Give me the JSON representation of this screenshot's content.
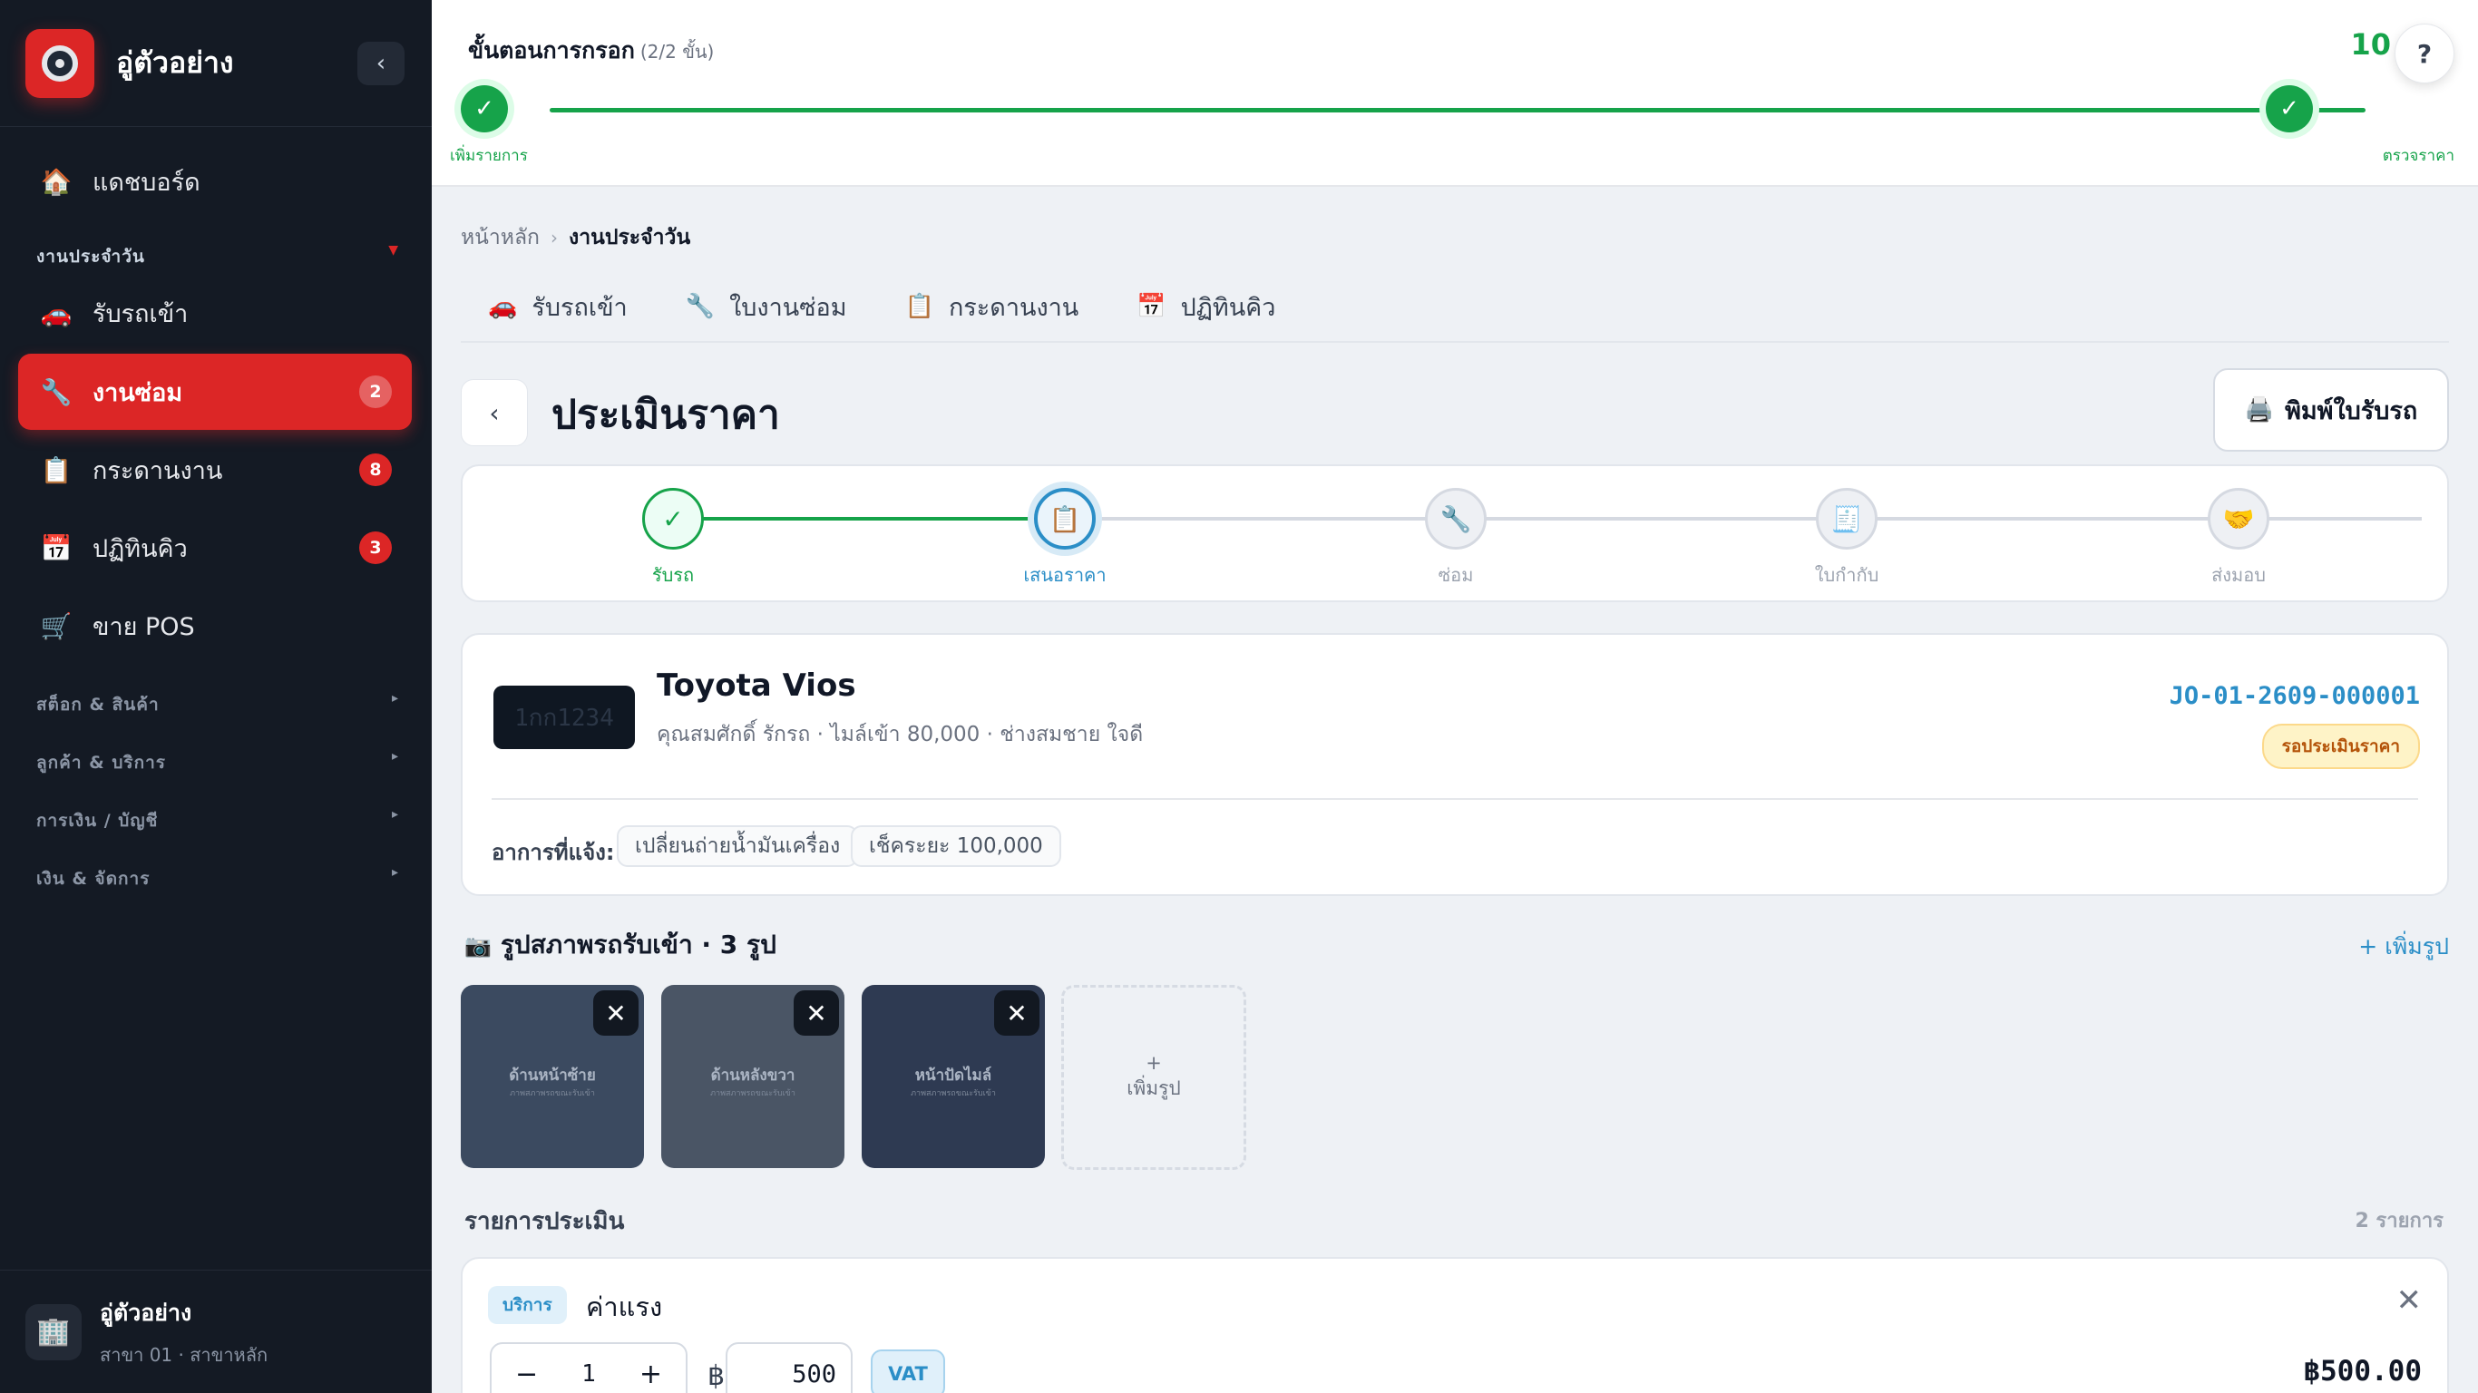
{
  "sidebar": {
    "app_name": "อู่ตัวอย่าง",
    "collapse_icon": "‹",
    "dashboard": "แดชบอร์ด",
    "section_daily": "งานประจำวัน",
    "items": [
      {
        "label": "รับรถเข้า",
        "badge": ""
      },
      {
        "label": "งานซ่อม",
        "badge": "2"
      },
      {
        "label": "กระดานงาน",
        "badge": "8"
      },
      {
        "label": "ปฏิทินคิว",
        "badge": "3"
      },
      {
        "label": "ขาย POS",
        "badge": ""
      }
    ],
    "sections": [
      "สต็อก & สินค้า",
      "ลูกค้า & บริการ",
      "การเงิน / บัญชี",
      "เงิน & จัดการ"
    ],
    "footer": {
      "name": "อู่ตัวอย่าง",
      "sub": "สาขา 01 · สาขาหลัก"
    }
  },
  "progress": {
    "title": "ขั้นตอนการกรอก",
    "step_count": "(2/2 ขั้น)",
    "percent_visible": "10",
    "percent_value": 100,
    "step1_label": "เพิ่มรายการ",
    "step2_label": "ตรวจราคา",
    "help": "?"
  },
  "breadcrumb": {
    "home": "หน้าหลัก",
    "current": "งานประจำวัน"
  },
  "tabs": [
    {
      "label": "รับรถเข้า",
      "icon": "car-icon"
    },
    {
      "label": "ใบงานซ่อม",
      "icon": "wrench-icon"
    },
    {
      "label": "กระดานงาน",
      "icon": "clipboard-icon"
    },
    {
      "label": "ปฏิทินคิว",
      "icon": "calendar-icon"
    }
  ],
  "page": {
    "title": "ประเมินราคา",
    "print_label": "พิมพ์ใบรับรถ",
    "back": "‹"
  },
  "stepper": [
    {
      "label": "รับรถ",
      "state": "done",
      "icon": "check-icon"
    },
    {
      "label": "เสนอราคา",
      "state": "current",
      "icon": "clipboard-icon"
    },
    {
      "label": "ซ่อม",
      "state": "todo",
      "icon": "wrench-icon"
    },
    {
      "label": "ใบกำกับ",
      "state": "todo",
      "icon": "receipt-icon"
    },
    {
      "label": "ส่งมอบ",
      "state": "todo",
      "icon": "handshake-icon"
    }
  ],
  "vehicle": {
    "plate": "1กก1234",
    "name": "Toyota Vios",
    "details": "คุณสมศักดิ์ รักรถ · ไมล์เข้า 80,000 · ช่างสมชาย ใจดี",
    "job_no": "JO-01-2609-000001",
    "status": "รอประเมินราคา",
    "symptom_label": "อาการที่แจ้ง:",
    "symptoms": [
      "เปลี่ยนถ่ายน้ำมันเครื่อง",
      "เช็คระยะ 100,000"
    ]
  },
  "photos": {
    "title": "รูปสภาพรถรับเข้า · 3 รูป",
    "add_link": "+ เพิ่มรูป",
    "items": [
      {
        "caption": "ด้านหน้าซ้าย",
        "sub": "ภาพสภาพรถขณะรับเข้า",
        "color": "#3b4a60"
      },
      {
        "caption": "ด้านหลังขวา",
        "sub": "ภาพสภาพรถขณะรับเข้า",
        "color": "#4a5565"
      },
      {
        "caption": "หน้าปัดไมล์",
        "sub": "ภาพสภาพรถขณะรับเข้า",
        "color": "#2e3a52"
      }
    ],
    "add_plus": "+",
    "add_label": "เพิ่มรูป"
  },
  "items": {
    "title": "รายการประเมิน",
    "count": "2 รายการ",
    "rows": [
      {
        "type": "บริการ",
        "name": "ค่าแรง",
        "qty": "1",
        "currency": "฿",
        "price": "500",
        "vat": "VAT",
        "total": "฿500.00"
      }
    ]
  },
  "colors": {
    "accent": "#dc2626",
    "success": "#16a34a",
    "info": "#2b8ec7",
    "sidebar_bg": "#141a24"
  }
}
